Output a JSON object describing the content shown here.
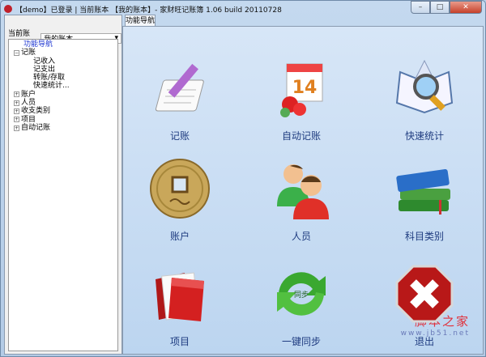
{
  "window": {
    "title": "【demo】已登录 | 当前账本 【我的账本】- 家财旺记账簿 1.06 build 20110728",
    "min": "–",
    "max": "□",
    "close": "✕"
  },
  "sidebar": {
    "account_label": "当前账本:",
    "account_value": "我的账本",
    "tree": [
      {
        "label": "功能导航",
        "level": 1,
        "selected": true
      },
      {
        "label": "记账",
        "level": 0,
        "expander": "−"
      },
      {
        "label": "记收入",
        "level": 2
      },
      {
        "label": "记支出",
        "level": 2
      },
      {
        "label": "转账/存取",
        "level": 2
      },
      {
        "label": "快速统计...",
        "level": 2
      },
      {
        "label": "账户",
        "level": 0,
        "expander": "+"
      },
      {
        "label": "人员",
        "level": 0,
        "expander": "+"
      },
      {
        "label": "收支类别",
        "level": 0,
        "expander": "+"
      },
      {
        "label": "项目",
        "level": 0,
        "expander": "+"
      },
      {
        "label": "自动记账",
        "level": 0,
        "expander": "+"
      }
    ]
  },
  "main": {
    "tab": "功能导航",
    "tiles": [
      {
        "label": "记账",
        "icon": "notepad-pencil-icon"
      },
      {
        "label": "自动记账",
        "icon": "calendar-icon",
        "badge": "14"
      },
      {
        "label": "快速统计",
        "icon": "magnifier-book-icon"
      },
      {
        "label": "账户",
        "icon": "coin-icon"
      },
      {
        "label": "人员",
        "icon": "users-icon"
      },
      {
        "label": "科目类别",
        "icon": "books-icon"
      },
      {
        "label": "项目",
        "icon": "folder-icon"
      },
      {
        "label": "一键同步",
        "icon": "sync-icon",
        "badge": "同步"
      },
      {
        "label": "退出",
        "icon": "exit-icon"
      }
    ]
  },
  "watermark": {
    "title": "脚本之家",
    "url": "www.jb51.net"
  },
  "colors": {
    "accent": "#1f3c80",
    "selected_tree": "#1a33d0"
  }
}
